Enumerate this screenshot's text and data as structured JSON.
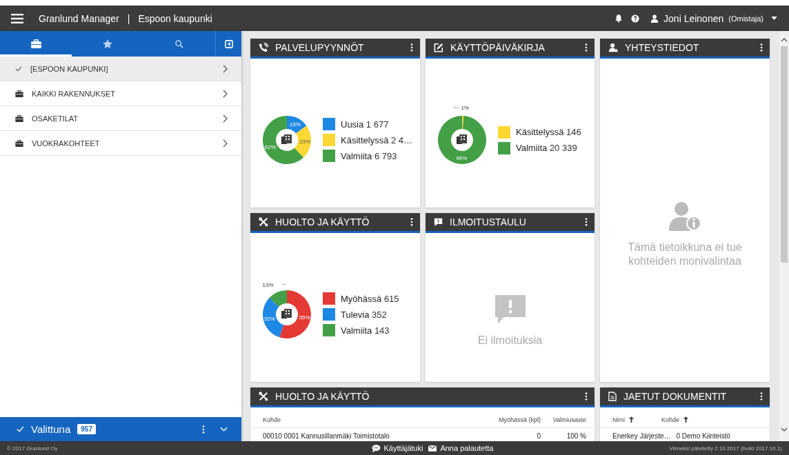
{
  "header": {
    "app_name": "Granlund Manager",
    "separator": "|",
    "organization": "Espoon kaupunki",
    "user_name": "Joni Leinonen",
    "user_role": "(Omistaja)"
  },
  "sidebar": {
    "tabs": [
      {
        "kind": "briefcase",
        "selected": true
      },
      {
        "kind": "star",
        "selected": false
      },
      {
        "kind": "search",
        "selected": false
      }
    ],
    "items": [
      {
        "label": "[ESPOON KAUPUNKI]",
        "selected": true
      },
      {
        "label": "KAIKKI RAKENNUKSET",
        "selected": false
      },
      {
        "label": "OSAKETILAT",
        "selected": false
      },
      {
        "label": "VUOKRAKOHTEET",
        "selected": false
      }
    ],
    "selection_bar": {
      "label": "Valittuna",
      "count": "957"
    }
  },
  "service_requests": {
    "title": "PALVELUPYYNNÖT",
    "legend": [
      {
        "value": "1 677",
        "color": "#1e88e5"
      },
      {
        "value": "2 4…",
        "color": "#fdd835"
      },
      {
        "value": "6 793",
        "color": "#43a047"
      }
    ],
    "chart_data": {
      "type": "donut",
      "categories": [
        "Uusia",
        "Käsittelyssä",
        "Valmiita"
      ],
      "values": [
        15,
        23,
        62
      ],
      "value_labels": [
        "15%",
        "23%",
        "62%"
      ]
    }
  },
  "operation_log": {
    "title": "KÄYTTÖPÄIVÄKIRJA",
    "legend": [
      {
        "value": "146",
        "color": "#fdd835"
      },
      {
        "value": "20 339",
        "color": "#43a047"
      }
    ],
    "chart_data": {
      "type": "donut",
      "categories": [
        "Käsittelyssä",
        "Valmiita"
      ],
      "values": [
        1,
        99
      ],
      "value_labels": [
        "1%",
        "99%"
      ]
    }
  },
  "contacts": {
    "title": "YHTEYSTIEDOT",
    "message": "Tämä tietoikkuna ei tue kohteiden monivalintaa"
  },
  "maintenance": {
    "title": "HUOLTO JA KÄYTTÖ",
    "legend": [
      {
        "value": "615",
        "color": "#e53935"
      },
      {
        "value": "352",
        "color": "#1e88e5"
      },
      {
        "value": "143",
        "color": "#43a047"
      }
    ],
    "chart_data": {
      "type": "donut",
      "categories": [
        "Myöhässä",
        "Tulevia",
        "Valmiita"
      ],
      "values": [
        55,
        32,
        13
      ],
      "value_labels": [
        "55%",
        "32%",
        "13%"
      ]
    }
  },
  "bulletin": {
    "title": "ILMOITUSTAULU",
    "message": "Ei ilmoituksia"
  },
  "maintenance_table": {
    "title": "HUOLTO JA KÄYTTÖ",
    "columns": [
      {
        "label": "Kohde"
      },
      {
        "label": "Myöhässä (kpl)"
      },
      {
        "label": "Valmiusaste"
      }
    ],
    "rows": [
      [
        "00010 0001 Kannusillanmäki Toimistotalo",
        "0",
        "100 %"
      ]
    ]
  },
  "shared_documents": {
    "title": "JAETUT DOKUMENTIT",
    "columns": [
      {
        "label": "Nimi",
        "sorted": true
      },
      {
        "label": "Kohde",
        "sorted": true
      }
    ],
    "rows": [
      [
        "Enerkey Järjeste…",
        "0 Demo Kiinteistö"
      ]
    ]
  },
  "footer": {
    "copyright": "© 2017 Granlund Oy",
    "links": [
      {
        "label": "Käyttäjätuki"
      },
      {
        "label": "Anna palautetta"
      }
    ],
    "updated": "Viimeksi päivitetty 2.10.2017 (build 2017.10.1)"
  }
}
